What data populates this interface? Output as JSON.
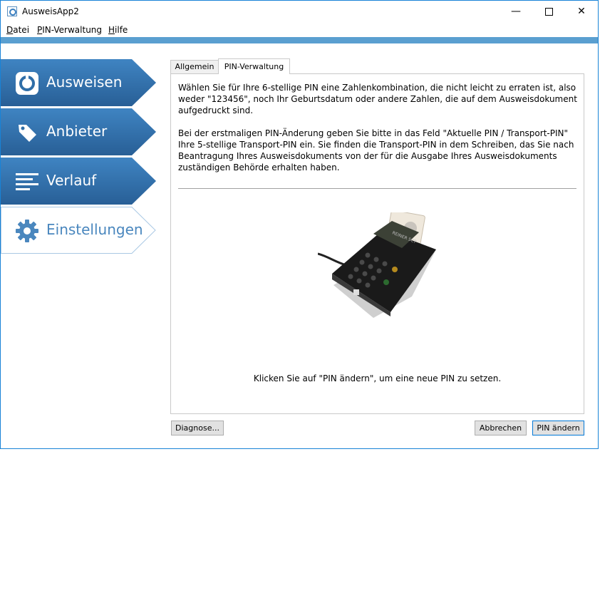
{
  "window": {
    "title": "AusweisApp2"
  },
  "menu": [
    {
      "mnemonic": "D",
      "rest": "atei"
    },
    {
      "mnemonic": "P",
      "rest": "IN-Verwaltung"
    },
    {
      "mnemonic": "H",
      "rest": "ilfe"
    }
  ],
  "sidebar": {
    "items": [
      {
        "label": "Ausweisen",
        "icon": "id-ring-icon",
        "active": true
      },
      {
        "label": "Anbieter",
        "icon": "tag-icon",
        "active": true
      },
      {
        "label": "Verlauf",
        "icon": "list-lines-icon",
        "active": true
      },
      {
        "label": "Einstellungen",
        "icon": "gear-icon",
        "active": false
      }
    ]
  },
  "tabs": [
    {
      "label": "Allgemein",
      "selected": false
    },
    {
      "label": "PIN-Verwaltung",
      "selected": true
    }
  ],
  "content": {
    "para1": "Wählen Sie für Ihre 6-stellige PIN eine Zahlenkombination, die nicht leicht zu erraten ist, also weder \"123456\", noch Ihr Geburtsdatum oder andere Zahlen, die auf dem Ausweisdokument aufgedruckt sind.",
    "para2": "Bei der erstmaligen PIN-Änderung geben Sie bitte in das Feld \"Aktuelle PIN / Transport-PIN\" Ihre 5-stellige Transport-PIN ein. Sie finden die Transport-PIN in dem Schreiben, das Sie nach Beantragung Ihres Ausweisdokuments von der für die Ausgabe Ihres Ausweisdokuments zuständigen Behörde erhalten haben.",
    "reader_brand": "REINER SCT",
    "hint": "Klicken Sie auf \"PIN ändern\", um eine neue PIN zu setzen."
  },
  "buttons": {
    "diagnose": "Diagnose...",
    "cancel": "Abbrechen",
    "change_pin": "PIN ändern"
  },
  "colors": {
    "accent": "#5a9fd0",
    "nav_active": "#2f6ea8",
    "nav_inactive_text": "#4a87be",
    "window_border": "#1883d7"
  }
}
